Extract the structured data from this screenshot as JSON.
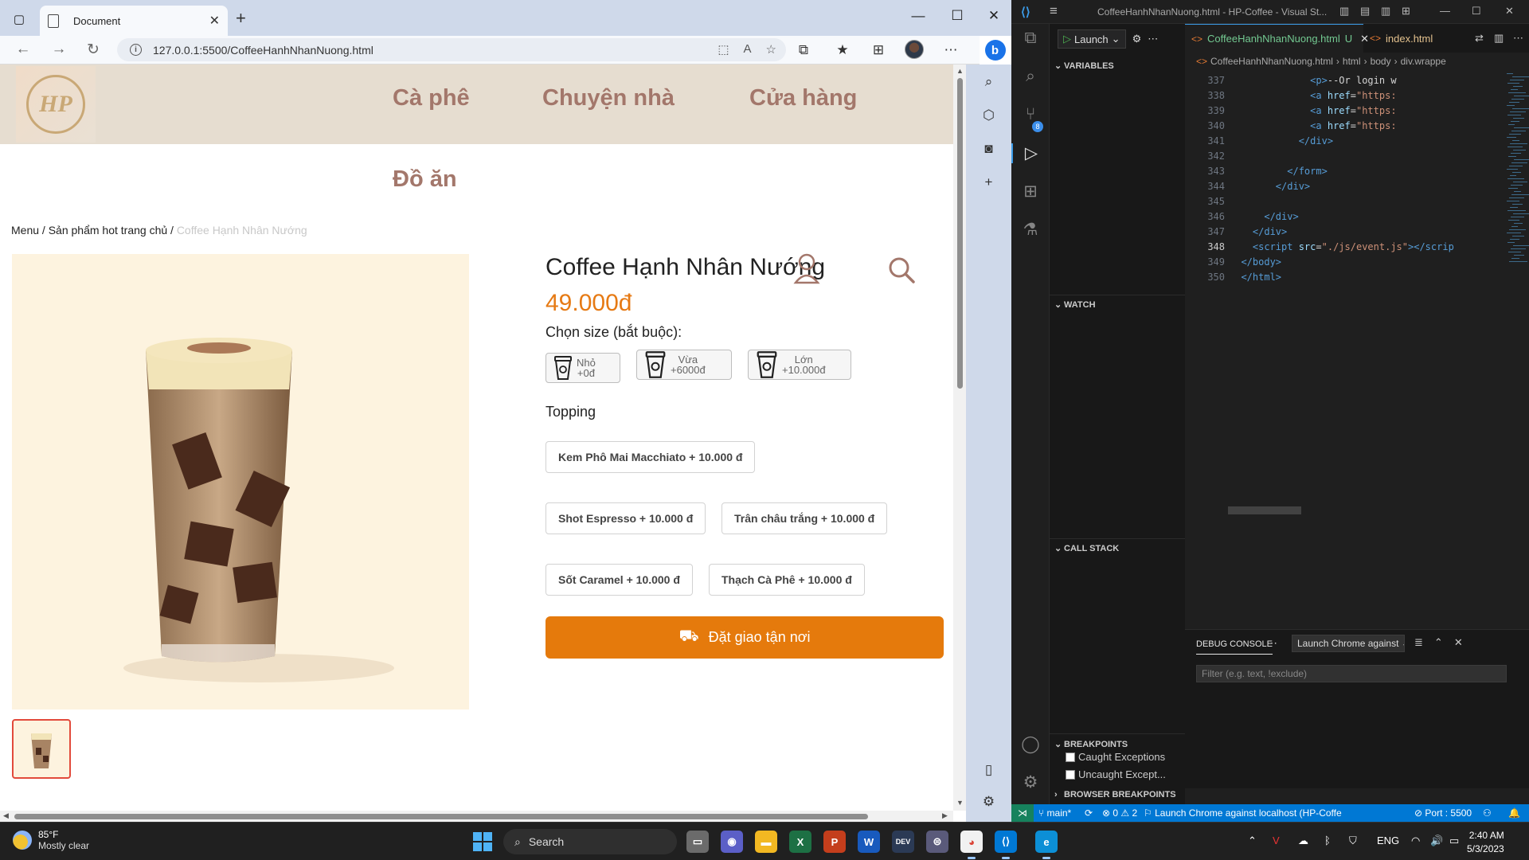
{
  "browser": {
    "tab_title": "Document",
    "url": "127.0.0.1:5500/CoffeeHanhNhanNuong.html"
  },
  "site": {
    "nav": [
      "Cà phê",
      "Chuyện nhà",
      "Cửa hàng",
      "Đồ ăn"
    ],
    "logo_text": "HP",
    "breadcrumb": {
      "item1": "Menu",
      "sep": " / ",
      "item2": "Sản phẩm hot trang chủ",
      "current": "Coffee Hạnh Nhân Nướng"
    },
    "product": {
      "title": "Coffee Hạnh Nhân Nướng",
      "price": "49.000đ",
      "size_label": "Chọn size (bắt buộc):",
      "sizes": [
        {
          "name": "Nhỏ",
          "price": "+0đ"
        },
        {
          "name": "Vừa",
          "price": "+6000đ"
        },
        {
          "name": "Lớn",
          "price": "+10.000đ"
        }
      ],
      "topping_label": "Topping",
      "toppings": [
        "Kem Phô Mai Macchiato + 10.000 đ",
        "Shot Espresso + 10.000 đ",
        "Trân châu trắng + 10.000 đ",
        "Sốt Caramel + 10.000 đ",
        "Thạch Cà Phê + 10.000 đ"
      ],
      "order_button": "Đặt giao tận nơi"
    }
  },
  "vscode": {
    "window_title": "CoffeeHanhNhanNuong.html - HP-Coffee - Visual St...",
    "launch_config": "Launch",
    "tabs": [
      {
        "name": "CoffeeHanhNhanNuong.html",
        "status": "U"
      },
      {
        "name": "index.html",
        "status": ""
      }
    ],
    "breadcrumbs": [
      "CoffeeHanhNhanNuong.html",
      "html",
      "body",
      "div.wrappe"
    ],
    "sections": {
      "variables": "VARIABLES",
      "watch": "WATCH",
      "call_stack": "CALL STACK",
      "breakpoints": "BREAKPOINTS",
      "browser_breakpoints": "BROWSER BREAKPOINTS"
    },
    "breakpoint_options": [
      "Caught Exceptions",
      "Uncaught Except..."
    ],
    "code_lines": [
      {
        "n": "337",
        "indent": "              ",
        "parts": [
          [
            "tag",
            "<p>"
          ],
          [
            "txt",
            "--Or login w"
          ]
        ]
      },
      {
        "n": "338",
        "indent": "              ",
        "parts": [
          [
            "tag",
            "<a "
          ],
          [
            "attr",
            "href"
          ],
          [
            "txt",
            "="
          ],
          [
            "str",
            "\"https:"
          ]
        ]
      },
      {
        "n": "339",
        "indent": "              ",
        "parts": [
          [
            "tag",
            "<a "
          ],
          [
            "attr",
            "href"
          ],
          [
            "txt",
            "="
          ],
          [
            "str",
            "\"https:"
          ]
        ]
      },
      {
        "n": "340",
        "indent": "              ",
        "parts": [
          [
            "tag",
            "<a "
          ],
          [
            "attr",
            "href"
          ],
          [
            "txt",
            "="
          ],
          [
            "str",
            "\"https:"
          ]
        ]
      },
      {
        "n": "341",
        "indent": "            ",
        "parts": [
          [
            "tag",
            "</div>"
          ]
        ]
      },
      {
        "n": "342",
        "indent": "",
        "parts": []
      },
      {
        "n": "343",
        "indent": "          ",
        "parts": [
          [
            "tag",
            "</form>"
          ]
        ]
      },
      {
        "n": "344",
        "indent": "        ",
        "parts": [
          [
            "tag",
            "</div>"
          ]
        ]
      },
      {
        "n": "345",
        "indent": "",
        "parts": []
      },
      {
        "n": "346",
        "indent": "      ",
        "parts": [
          [
            "tag",
            "</div>"
          ]
        ]
      },
      {
        "n": "347",
        "indent": "    ",
        "parts": [
          [
            "tag",
            "</div>"
          ]
        ]
      },
      {
        "n": "348",
        "indent": "    ",
        "parts": [
          [
            "tag",
            "<script "
          ],
          [
            "attr",
            "src"
          ],
          [
            "txt",
            "="
          ],
          [
            "str",
            "\"./js/event.js\""
          ],
          [
            "tag",
            "></scrip"
          ]
        ]
      },
      {
        "n": "349",
        "indent": "  ",
        "parts": [
          [
            "tag",
            "</body>"
          ]
        ]
      },
      {
        "n": "350",
        "indent": "  ",
        "parts": [
          [
            "tag",
            "</html>"
          ]
        ]
      }
    ],
    "current_line": "348",
    "panel": {
      "tab": "DEBUG CONSOLE",
      "launch_select": "Launch Chrome against",
      "filter_placeholder": "Filter (e.g. text, !exclude)"
    },
    "status": {
      "branch": "main*",
      "problems": "⊗ 0 ⚠ 2",
      "launch": "Launch Chrome against localhost (HP-Coffe",
      "port": "Port : 5500"
    }
  },
  "taskbar": {
    "temp": "85°F",
    "weather": "Mostly clear",
    "search": "Search",
    "lang": "ENG",
    "time": "2:40 AM",
    "date": "5/3/2023"
  },
  "colors": {
    "accent_orange": "#e57a0c",
    "price_orange": "#e67a14",
    "nav_brown": "#a3776b",
    "header_beige": "#e6ddd0",
    "vscode_blue": "#0078d4"
  }
}
